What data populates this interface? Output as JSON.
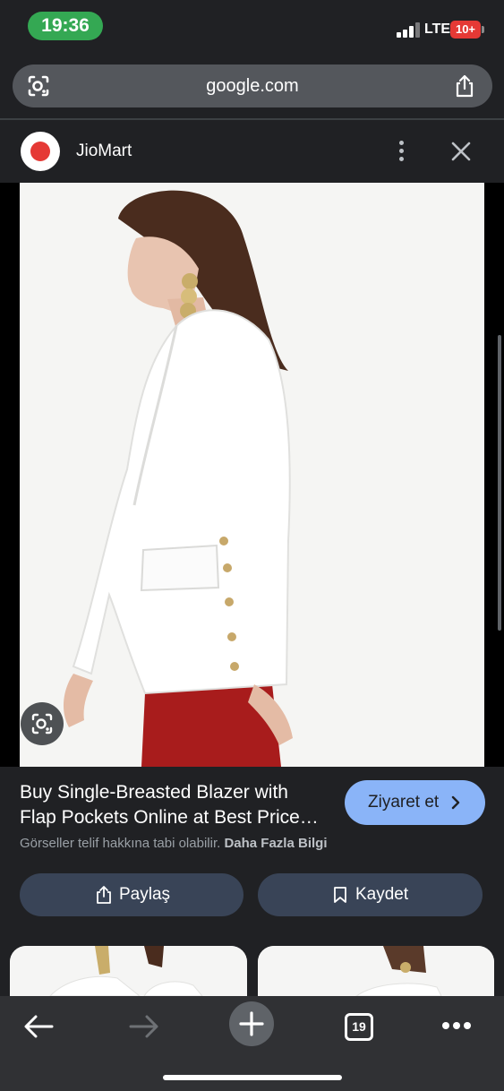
{
  "status_bar": {
    "time": "19:36",
    "network": "LTE",
    "battery": "10+",
    "time_color": "#34a853",
    "battery_color": "#e53935"
  },
  "url_bar": {
    "domain": "google.com",
    "left_icon": "lens-icon",
    "right_icon": "share-icon"
  },
  "panel": {
    "site_name": "JioMart",
    "site_logo": "jiomart-logo",
    "more_icon": "more-vert-icon",
    "close_icon": "close-icon"
  },
  "image": {
    "alt": "Woman in white single-breasted blazer with gold buttons and red trousers",
    "lens_icon": "lens-icon"
  },
  "result": {
    "title_line1": "Buy Single-Breasted Blazer with",
    "title_line2": "Flap Pockets Online at Best Price…",
    "visit_label": "Ziyaret et",
    "copyright_text": "Görseller telif hakkına tabi olabilir.",
    "more_info_label": "Daha Fazla Bilgi",
    "share_label": "Paylaş",
    "save_label": "Kaydet",
    "accent_color": "#8ab4f8"
  },
  "toolbar": {
    "back_icon": "back-arrow-icon",
    "forward_icon": "forward-arrow-icon",
    "new_tab_icon": "plus-icon",
    "tab_count": "19",
    "menu_icon": "more-horiz-icon"
  }
}
